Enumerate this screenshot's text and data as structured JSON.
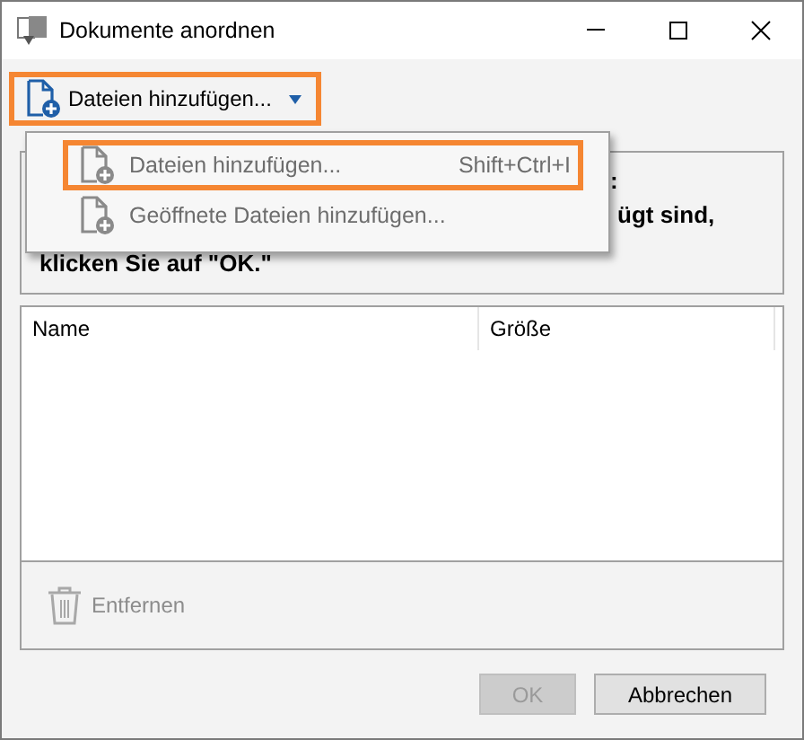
{
  "window": {
    "title": "Dokumente anordnen"
  },
  "toolbar": {
    "add_button": {
      "label": "Dateien hinzufügen...",
      "highlighted": true
    }
  },
  "menu": {
    "items": [
      {
        "label": "Dateien hinzufügen...",
        "shortcut": "Shift+Ctrl+I",
        "highlighted": true
      },
      {
        "label": "Geöffnete Dateien hinzufügen...",
        "highlighted": false
      }
    ]
  },
  "instructions": {
    "lines": [
      ":",
      "ügt sind,",
      "klicken Sie auf \"OK.\""
    ]
  },
  "table": {
    "columns": [
      "Name",
      "Größe"
    ]
  },
  "remove_button": {
    "label": "Entfernen",
    "disabled": true
  },
  "buttons": [
    {
      "label": "OK",
      "disabled": true
    },
    {
      "label": "Abbrechen",
      "disabled": false
    }
  ]
}
